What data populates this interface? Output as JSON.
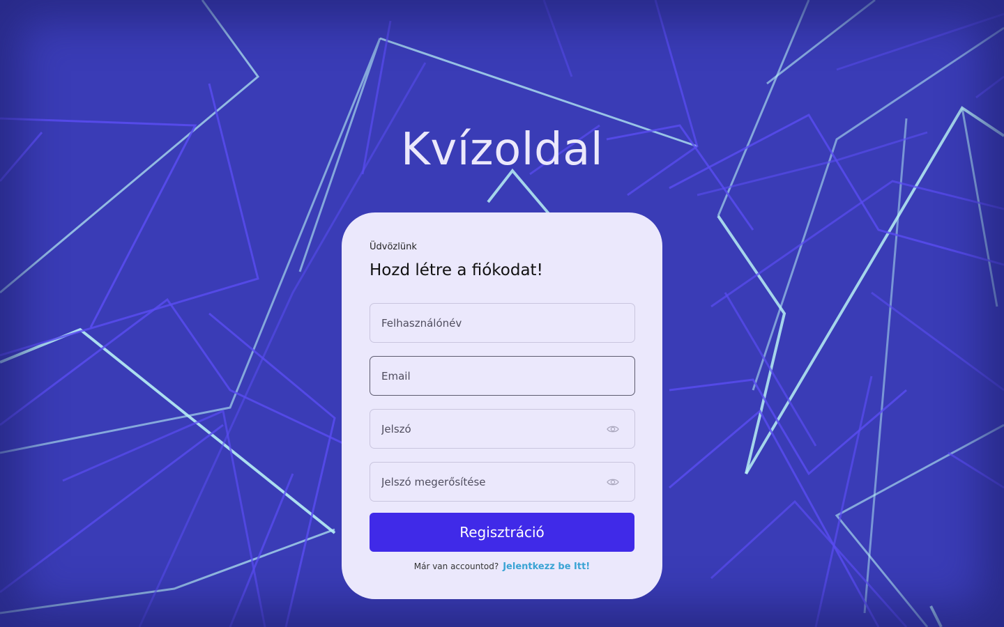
{
  "app": {
    "title": "Kvízoldal"
  },
  "form": {
    "welcome": "Üdvözlünk",
    "heading": "Hozd létre a fiókodat!",
    "fields": {
      "username": {
        "value": "",
        "placeholder": "Felhasználónév"
      },
      "email": {
        "value": "",
        "placeholder": "Email"
      },
      "password": {
        "value": "",
        "placeholder": "Jelszó"
      },
      "password_confirm": {
        "value": "",
        "placeholder": "Jelszó megerősítése"
      }
    },
    "submit_label": "Regisztráció",
    "login_prompt": "Már van accountod?",
    "login_link": "Jelentkezz be Itt!"
  },
  "icons": {
    "password_toggle": "eye-icon",
    "password_confirm_toggle": "eye-icon"
  },
  "colors": {
    "background": "#3a3cb6",
    "card": "#ebe8fc",
    "accent": "#402ae8",
    "link": "#3aa3d4",
    "line_violet": "#5a4cf2",
    "line_cyan": "#b8f0f5"
  }
}
